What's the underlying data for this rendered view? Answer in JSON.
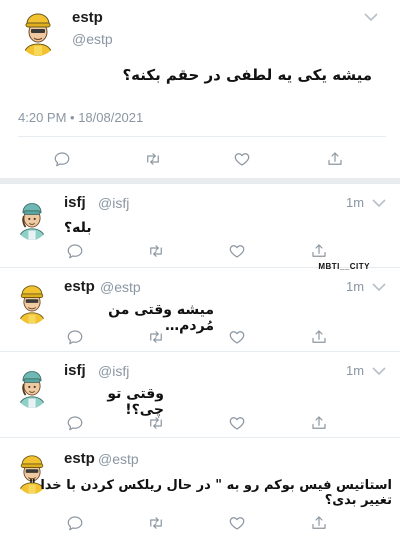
{
  "main_tweet": {
    "name": "estp",
    "handle": "@estp",
    "text": "میشه یکی یه لطفی در حقم بکنه؟",
    "timestamp": "4:20 PM • 18/08/2021"
  },
  "replies": [
    {
      "name": "isfj",
      "handle": "@isfj",
      "time": "1m",
      "text": "بله؟",
      "avatar": "nurse-avatar-icon"
    },
    {
      "name": "estp",
      "handle": "@estp",
      "time": "1m",
      "text": "میشه وقتی من مُردم…",
      "avatar": "yellow-cap-avatar-icon"
    },
    {
      "name": "isfj",
      "handle": "@isfj",
      "time": "1m",
      "text": "وقتی تو چی؟!",
      "avatar": "nurse-avatar-icon"
    },
    {
      "name": "estp",
      "handle": "@estp",
      "time": "",
      "text": "استاتیس فیس بوکم رو به \" در حال ریلکس کردن با خدا \" تغییر بدی؟",
      "avatar": "yellow-cap-avatar-icon"
    }
  ],
  "watermark": "MBTI__CITY",
  "icons": {
    "reply": "reply-icon",
    "retweet": "retweet-icon",
    "like": "heart-icon",
    "share": "share-icon",
    "menu": "chevron-down-icon"
  },
  "colors": {
    "icon_gray": "#8c96a1",
    "text_gray": "#8a96a3",
    "estp_cap": "#f2c230",
    "isfj_cap": "#6fb8b3"
  }
}
